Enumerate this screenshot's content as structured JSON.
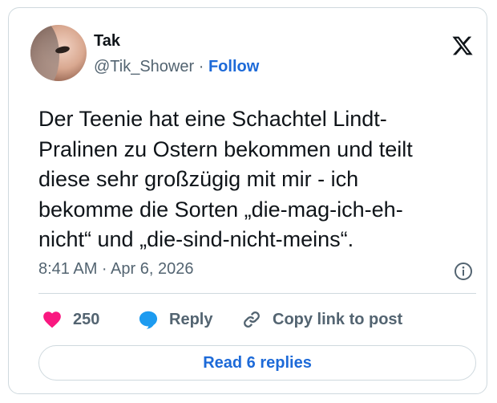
{
  "author": {
    "name": "Tak",
    "handle": "@Tik_Shower",
    "separator": "·",
    "follow_label": "Follow"
  },
  "tweet": {
    "text": "Der Teenie hat eine Schachtel Lindt-\nPralinen zu Ostern bekommen und teilt\ndiese sehr großzügig mit mir - ich\nbekomme die Sorten „die-mag-ich-eh-\nnicht“ und „die-sind-nicht-meins“.",
    "timestamp": "8:41 AM · Apr 6, 2026"
  },
  "actions": {
    "like_count": "250",
    "reply_label": "Reply",
    "copy_label": "Copy link to post",
    "read_replies_label": "Read 6 replies"
  },
  "icons": {
    "logo": "x-logo-icon",
    "info": "info-icon",
    "like": "heart-icon",
    "reply": "speech-bubble-icon",
    "copy": "link-icon"
  },
  "colors": {
    "like": "#f91880",
    "reply": "#1d9bf0",
    "link": "#1d6ad8",
    "muted": "#536471"
  }
}
